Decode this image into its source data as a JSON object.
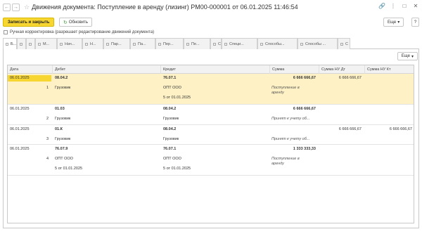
{
  "window": {
    "title": "Движения документа: Поступление в аренду (лизинг) РМ00-000001 от 06.01.2025 11:46:54",
    "back_glyph": "←",
    "forward_glyph": "→",
    "star_glyph": "☆",
    "icons": [
      "link-icon",
      "more-icon",
      "maximize-icon",
      "close-icon"
    ],
    "icon_glyphs": [
      "🔗",
      "⋮",
      "□",
      "✕"
    ]
  },
  "toolbar": {
    "save_close_label": "Записать и закрыть",
    "refresh_label": "Обновить",
    "refresh_glyph": "↻",
    "more_label": "Еще",
    "more_arrow": "▾",
    "help_label": "?"
  },
  "manual_adjust_label": "Ручная корректировка (разрешает редактирование движений документа)",
  "tabs": [
    {
      "label": "Б..."
    },
    {
      "label": ""
    },
    {
      "label": ""
    },
    {
      "label": "М..."
    },
    {
      "label": "Нач..."
    },
    {
      "label": "Н..."
    },
    {
      "label": "Пар..."
    },
    {
      "label": "Па..."
    },
    {
      "label": "Пер..."
    },
    {
      "label": "Пе..."
    },
    {
      "label": "С"
    },
    {
      "label": "Специ..."
    },
    {
      "label": "Способы..."
    },
    {
      "label": "Способы ..."
    },
    {
      "label": "С"
    }
  ],
  "panel_more_label": "Еще",
  "grid": {
    "columns": [
      "Дата",
      "Дебет",
      "Кредит",
      "Сумма",
      "Сумма НУ Дт",
      "Сумма НУ Кт"
    ],
    "rows": [
      {
        "date": "06.01.2025",
        "num": "1",
        "debit": [
          "08.04.2",
          "Грузовик",
          ""
        ],
        "credit": [
          "76.07.1",
          "ОПТ ООО",
          "5 от 01.01.2025"
        ],
        "sum": "6 666 666,67",
        "sum_note": [
          "Поступление в",
          "аренду"
        ],
        "nu_dt": "6 666 666,67",
        "nu_kt": "",
        "selected": true
      },
      {
        "date": "06.01.2025",
        "num": "2",
        "debit": [
          "01.03",
          "Грузовик",
          ""
        ],
        "credit": [
          "08.04.2",
          "Грузовик",
          ""
        ],
        "sum": "6 666 666,67",
        "sum_note": [
          "Принят к учету об...",
          ""
        ],
        "nu_dt": "",
        "nu_kt": "",
        "selected": false
      },
      {
        "date": "06.01.2025",
        "num": "3",
        "debit": [
          "01.К",
          "Грузовик",
          ""
        ],
        "credit": [
          "08.04.2",
          "Грузовик",
          ""
        ],
        "sum": "",
        "sum_note": [
          "Принят к учету об...",
          ""
        ],
        "nu_dt": "6 666 666,67",
        "nu_kt": "6 666 666,67",
        "selected": false
      },
      {
        "date": "06.01.2025",
        "num": "4",
        "debit": [
          "76.07.9",
          "ОПТ ООО",
          "5 от 01.01.2025"
        ],
        "credit": [
          "76.07.1",
          "ОПТ ООО",
          "5 от 01.01.2025"
        ],
        "sum": "1 333 333,33",
        "sum_note": [
          "Поступление в",
          "аренду"
        ],
        "nu_dt": "",
        "nu_kt": "",
        "selected": false
      }
    ]
  }
}
